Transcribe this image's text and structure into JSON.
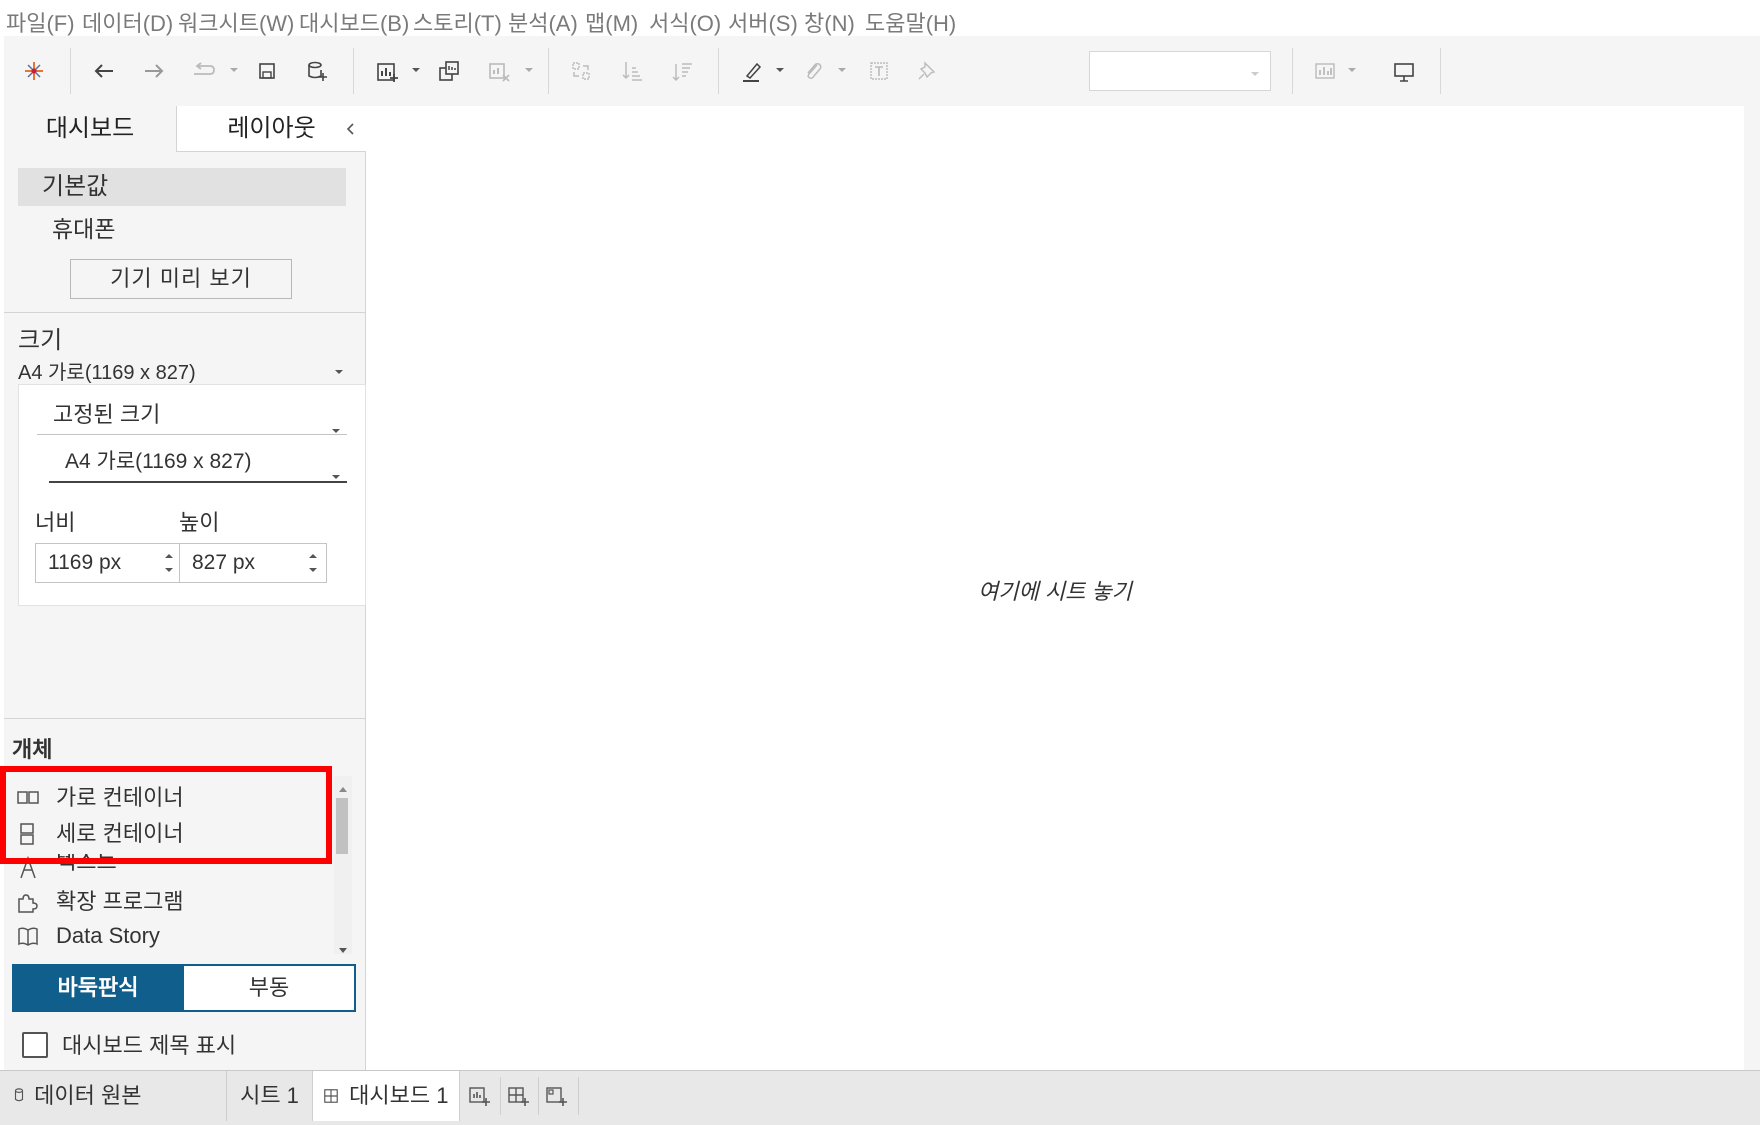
{
  "menu": [
    "파일(F)",
    "데이터(D)",
    "워크시트(W)",
    "대시보드(B)",
    "스토리(T)",
    "분석(A)",
    "맵(M)",
    "서식(O)",
    "서버(S)",
    "창(N)",
    "도움말(H)"
  ],
  "toolbar": {
    "icons": [
      "tableau-logo-icon",
      "undo-icon",
      "redo-icon",
      "replay-icon",
      "save-icon",
      "new-datasource-icon",
      "new-worksheet-icon",
      "duplicate-icon",
      "clear-sheet-icon",
      "swap-icon",
      "sort-ascending-icon",
      "sort-descending-icon",
      "highlight-icon",
      "group-icon",
      "labels-icon",
      "pin-icon",
      "show-me-icon",
      "presentation-icon"
    ],
    "fit_dropdown_value": ""
  },
  "sidebar": {
    "tabs": [
      "대시보드",
      "레이아웃"
    ],
    "devices": {
      "default": "기본값",
      "phone": "휴대폰"
    },
    "preview_button": "기기 미리 보기",
    "size": {
      "label": "크기",
      "value": "A4 가로(1169 x 827)",
      "mode": "고정된 크기",
      "preset": "A4 가로(1169 x 827)",
      "width_label": "너비",
      "height_label": "높이",
      "width_value": "1169 px",
      "height_value": "827 px"
    },
    "objects": {
      "label": "개체",
      "items": [
        {
          "label": "가로 컨테이너",
          "icon": "horizontal-container-icon"
        },
        {
          "label": "세로 컨테이너",
          "icon": "vertical-container-icon"
        },
        {
          "label": "텍스트",
          "icon": "text-icon"
        },
        {
          "label": "확장 프로그램",
          "icon": "extension-icon"
        },
        {
          "label": "Data Story",
          "icon": "book-icon"
        }
      ]
    },
    "layout_mode": {
      "tiled": "바둑판식",
      "floating": "부동"
    },
    "show_title": "대시보드 제목 표시"
  },
  "canvas": {
    "drop_hint": "여기에 시트 놓기"
  },
  "bottom_tabs": {
    "data_source": "데이터 원본",
    "sheet": "시트 1",
    "dashboard": "대시보드 1"
  },
  "colors": {
    "accent": "#0f5e8c",
    "highlight_box": "#ff0000"
  }
}
